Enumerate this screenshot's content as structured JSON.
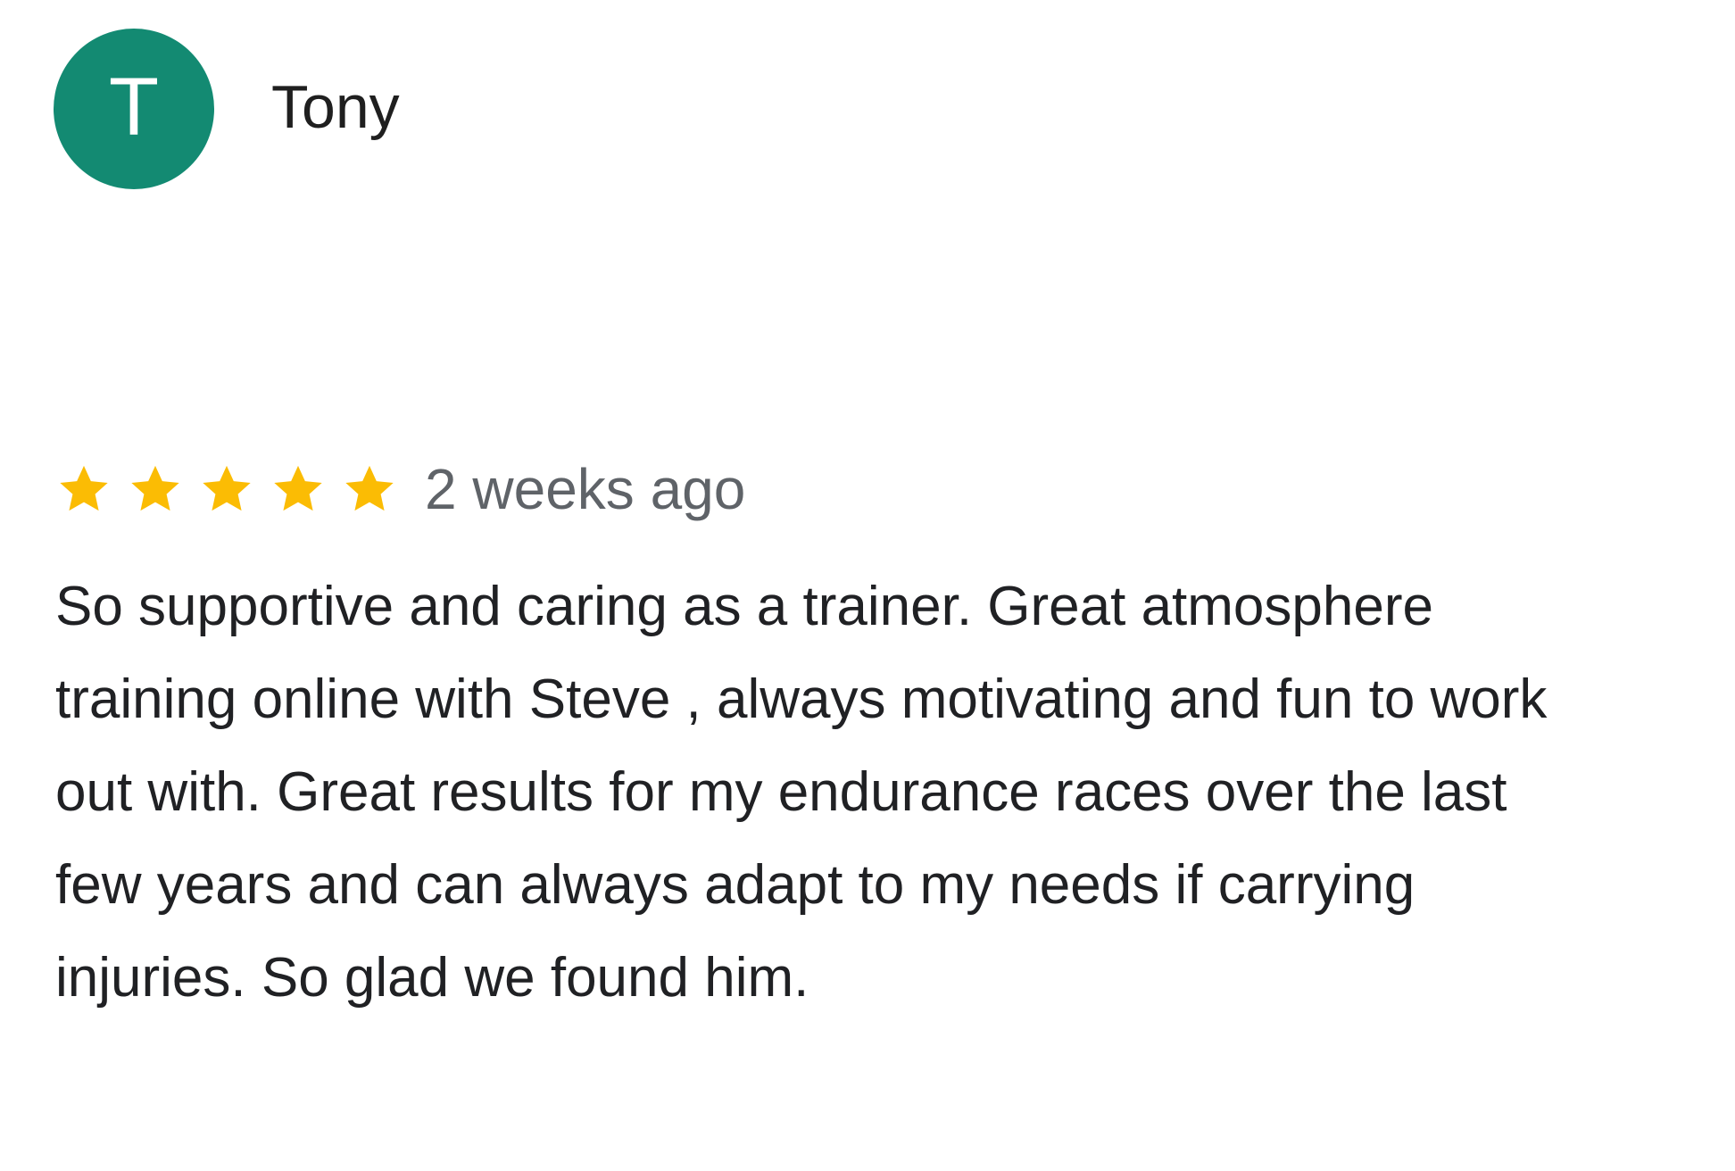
{
  "review": {
    "avatar_letter": "T",
    "avatar_color": "#138a72",
    "reviewer_name": "Tony",
    "rating": 5,
    "rating_max": 5,
    "star_color": "#fbbc04",
    "date": "2 weeks ago",
    "text": "So supportive and caring as a trainer. Great atmosphere training online with Steve , always motivating and fun to work out with. Great results for my endurance races over the last few years and can always adapt to my needs if carrying injuries. So glad we found him."
  }
}
